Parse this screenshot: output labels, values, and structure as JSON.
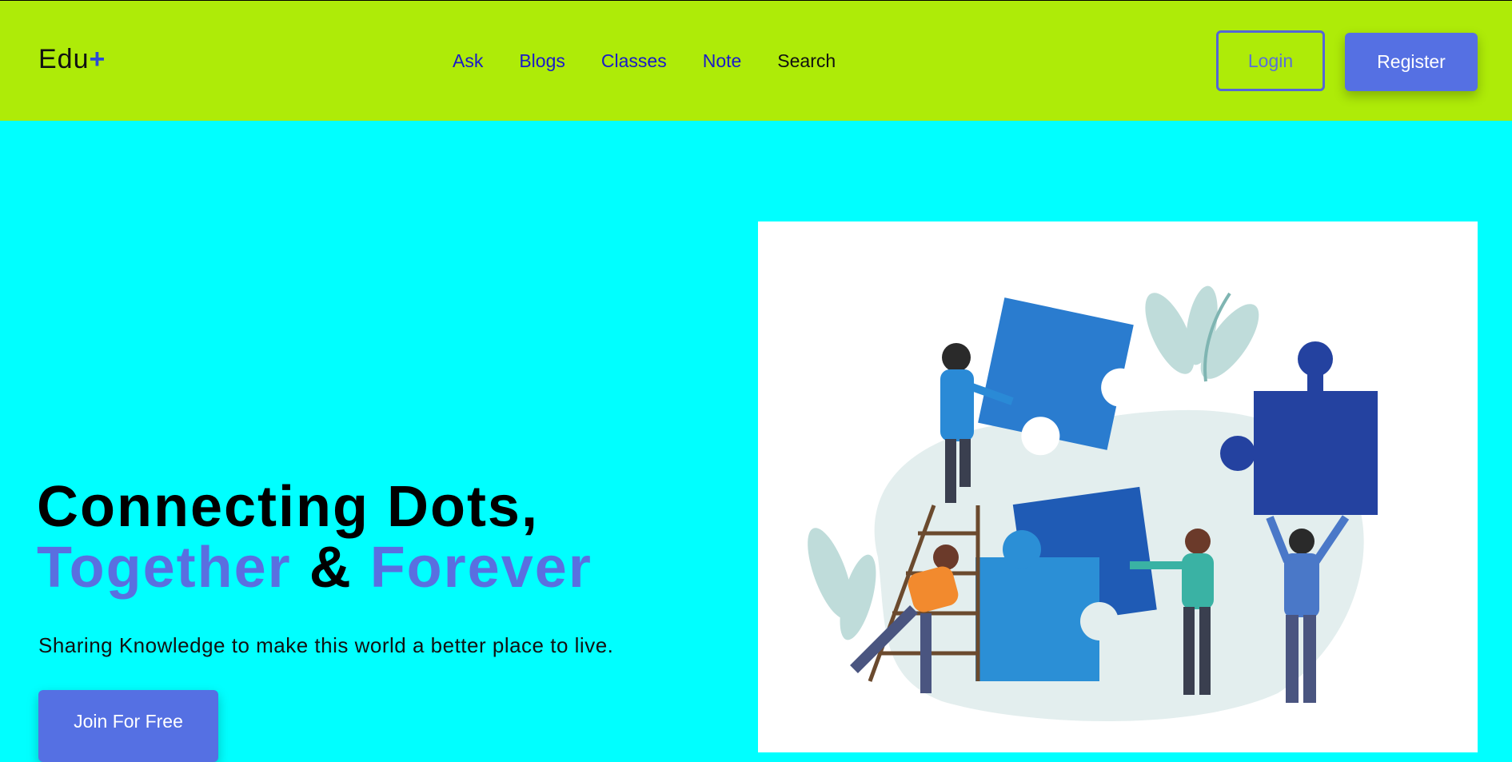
{
  "header": {
    "logo_text": "Edu",
    "logo_plus": "+",
    "nav": [
      {
        "label": "Ask"
      },
      {
        "label": "Blogs"
      },
      {
        "label": "Classes"
      },
      {
        "label": "Note"
      },
      {
        "label": "Search"
      }
    ],
    "login_label": "Login",
    "register_label": "Register"
  },
  "hero": {
    "title_line1": "Connecting Dots,",
    "title_word1": "Together",
    "title_amp": "&",
    "title_word2": "Forever",
    "subtitle": "Sharing Knowledge to make this world a better place to live.",
    "cta_label": "Join For Free"
  },
  "colors": {
    "navbar_bg": "#aeeb08",
    "page_bg": "#00ffff",
    "accent": "#5570e3",
    "nav_link": "#1a1ac8"
  },
  "illustration": {
    "icon": "teamwork-puzzle-illustration"
  }
}
